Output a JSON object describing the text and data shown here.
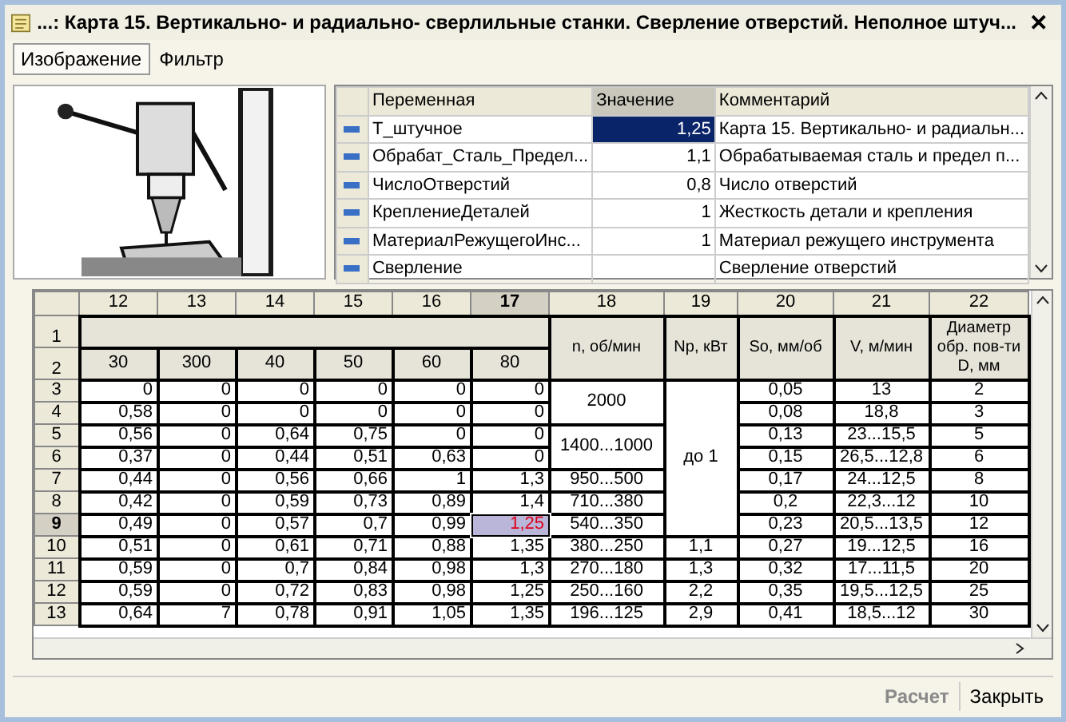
{
  "window": {
    "title": "...: Карта 15. Вертикально- и радиально- сверлильные станки. Сверление отверстий. Неполное штуч...",
    "close": "✕"
  },
  "tabs": [
    {
      "label": "Изображение",
      "selected": true
    },
    {
      "label": "Фильтр",
      "selected": false
    }
  ],
  "variables": {
    "columns": [
      "Переменная",
      "Значение",
      "Комментарий"
    ],
    "rows": [
      {
        "name": "Т_штучное",
        "value": "1,25",
        "comment": "Карта 15. Вертикально- и радиальн...",
        "selected": true
      },
      {
        "name": "Обрабат_Сталь_Предел...",
        "value": "1,1",
        "comment": "Обрабатываемая сталь и предел п...",
        "selected": false
      },
      {
        "name": "ЧислоОтверстий",
        "value": "0,8",
        "comment": "Число отверстий",
        "selected": false
      },
      {
        "name": "КреплениеДеталей",
        "value": "1",
        "comment": "Жесткость детали и крепления",
        "selected": false
      },
      {
        "name": "МатериалРежущегоИнс...",
        "value": "1",
        "comment": "Материал режущего инструмента",
        "selected": false
      },
      {
        "name": "Сверление",
        "comment": "Сверление отверстий",
        "selected": false
      }
    ]
  },
  "table": {
    "columns": [
      {
        "label": "12",
        "selected": false
      },
      {
        "label": "13",
        "selected": false
      },
      {
        "label": "14",
        "selected": false
      },
      {
        "label": "15",
        "selected": false
      },
      {
        "label": "16",
        "selected": false
      },
      {
        "label": "17",
        "selected": true
      }
    ],
    "right_columns": [
      {
        "label": "18",
        "heading": "n, об/мин"
      },
      {
        "label": "19",
        "heading": "Np, кВт"
      },
      {
        "label": "20",
        "heading": "So, мм/об"
      },
      {
        "label": "21",
        "heading": "V, м/мин"
      },
      {
        "label": "22",
        "heading": "Диаметр обр. пов-ти D, мм"
      }
    ],
    "header_rows": [
      {
        "label": "1"
      },
      {
        "label": "2",
        "values": [
          "30",
          "300",
          "40",
          "50",
          "60",
          "80"
        ]
      }
    ],
    "rows": [
      {
        "label": "3",
        "selected": false,
        "values": [
          "0",
          "0",
          "0",
          "0",
          "0",
          "0"
        ],
        "n": "2000",
        "np": "до 1",
        "so": "0,05",
        "v": "13",
        "d": "2"
      },
      {
        "label": "4",
        "selected": false,
        "values": [
          "0,58",
          "0",
          "0",
          "0",
          "0",
          "0"
        ],
        "so": "0,08",
        "v": "18,8",
        "d": "3"
      },
      {
        "label": "5",
        "selected": false,
        "values": [
          "0,56",
          "0",
          "0,64",
          "0,75",
          "0",
          "0"
        ],
        "n": "1400...1000",
        "so": "0,13",
        "v": "23...15,5",
        "d": "5"
      },
      {
        "label": "6",
        "selected": false,
        "values": [
          "0,37",
          "0",
          "0,44",
          "0,51",
          "0,63",
          "0"
        ],
        "so": "0,15",
        "v": "26,5...12,8",
        "d": "6"
      },
      {
        "label": "7",
        "selected": false,
        "values": [
          "0,44",
          "0",
          "0,56",
          "0,66",
          "1",
          "1,3"
        ],
        "n": "950...500",
        "so": "0,17",
        "v": "24...12,5",
        "d": "8"
      },
      {
        "label": "8",
        "selected": false,
        "values": [
          "0,42",
          "0",
          "0,59",
          "0,73",
          "0,89",
          "1,4"
        ],
        "n": "710...380",
        "so": "0,2",
        "v": "22,3...12",
        "d": "10"
      },
      {
        "label": "9",
        "selected": true,
        "values": [
          "0,49",
          "0",
          "0,57",
          "0,7",
          "0,99",
          "1,25"
        ],
        "n": "540...350",
        "so": "0,23",
        "v": "20,5...13,5",
        "d": "12"
      },
      {
        "label": "10",
        "selected": false,
        "values": [
          "0,51",
          "0",
          "0,61",
          "0,71",
          "0,88",
          "1,35"
        ],
        "n": "380...250",
        "np": "1,1",
        "so": "0,27",
        "v": "19...12,5",
        "d": "16"
      },
      {
        "label": "11",
        "selected": false,
        "values": [
          "0,59",
          "0",
          "0,7",
          "0,84",
          "0,98",
          "1,3"
        ],
        "n": "270...180",
        "np": "1,3",
        "so": "0,32",
        "v": "17...11,5",
        "d": "20"
      },
      {
        "label": "12",
        "selected": false,
        "values": [
          "0,59",
          "0",
          "0,72",
          "0,83",
          "0,98",
          "1,25"
        ],
        "n": "250...160",
        "np": "2,2",
        "so": "0,35",
        "v": "19,5...12,5",
        "d": "25"
      },
      {
        "label": "13",
        "selected": false,
        "values": [
          "0,64",
          "7",
          "0,78",
          "0,91",
          "1,05",
          "1,35"
        ],
        "n": "196...125",
        "np": "2,9",
        "so": "0,41",
        "v": "18,5...12",
        "d": "30"
      }
    ]
  },
  "buttons": [
    {
      "label": "Расчет",
      "disabled": true
    },
    {
      "label": "Закрыть",
      "disabled": false
    }
  ]
}
